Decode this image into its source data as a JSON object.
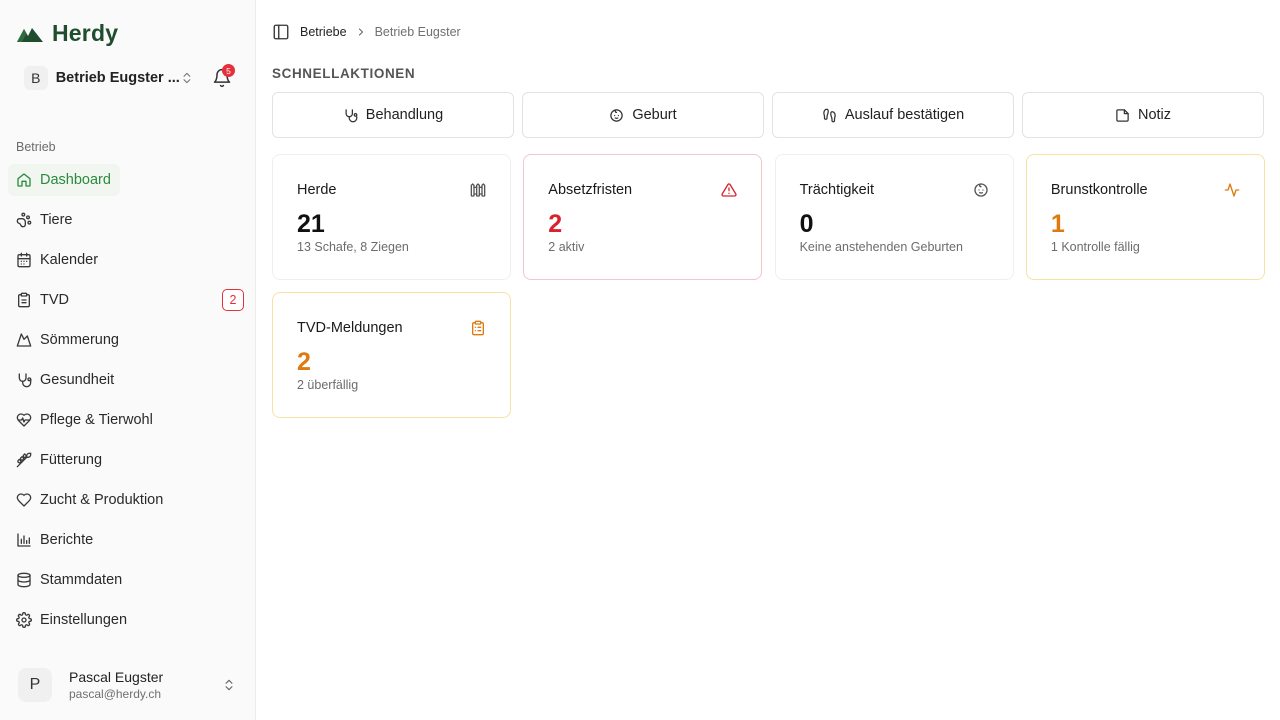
{
  "app": {
    "name": "Herdy"
  },
  "farm_switcher": {
    "avatar_letter": "B",
    "name": "Betrieb Eugster ..."
  },
  "notifications": {
    "count": "5"
  },
  "sidebar": {
    "section_label": "Betrieb",
    "items": [
      {
        "label": "Dashboard",
        "icon": "home-icon"
      },
      {
        "label": "Tiere",
        "icon": "paw-icon"
      },
      {
        "label": "Kalender",
        "icon": "calendar-icon"
      },
      {
        "label": "TVD",
        "icon": "clipboard-icon",
        "badge": "2"
      },
      {
        "label": "Sömmerung",
        "icon": "mountain-icon"
      },
      {
        "label": "Gesundheit",
        "icon": "stethoscope-icon"
      },
      {
        "label": "Pflege & Tierwohl",
        "icon": "heart-pulse-icon"
      },
      {
        "label": "Fütterung",
        "icon": "wheat-icon"
      },
      {
        "label": "Zucht & Produktion",
        "icon": "heart-icon"
      },
      {
        "label": "Berichte",
        "icon": "bar-chart-icon"
      },
      {
        "label": "Stammdaten",
        "icon": "database-icon"
      },
      {
        "label": "Einstellungen",
        "icon": "gear-icon"
      }
    ]
  },
  "user": {
    "avatar_letter": "P",
    "name": "Pascal Eugster",
    "email": "pascal@herdy.ch"
  },
  "breadcrumb": {
    "parent": "Betriebe",
    "current": "Betrieb Eugster"
  },
  "quick_actions": {
    "title": "SCHNELLAKTIONEN",
    "buttons": [
      {
        "label": "Behandlung",
        "icon": "stethoscope-icon"
      },
      {
        "label": "Geburt",
        "icon": "baby-icon"
      },
      {
        "label": "Auslauf bestätigen",
        "icon": "footprints-icon"
      },
      {
        "label": "Notiz",
        "icon": "note-icon"
      }
    ]
  },
  "cards": [
    {
      "title": "Herde",
      "value": "21",
      "sub": "13 Schafe, 8 Ziegen",
      "icon": "fence-icon",
      "tone": "neutral"
    },
    {
      "title": "Absetzfristen",
      "value": "2",
      "sub": "2 aktiv",
      "icon": "warning-icon",
      "tone": "red"
    },
    {
      "title": "Trächtigkeit",
      "value": "0",
      "sub": "Keine anstehenden Geburten",
      "icon": "baby-icon",
      "tone": "neutral"
    },
    {
      "title": "Brunstkontrolle",
      "value": "1",
      "sub": "1 Kontrolle fällig",
      "icon": "activity-icon",
      "tone": "amber"
    },
    {
      "title": "TVD-Meldungen",
      "value": "2",
      "sub": "2 überfällig",
      "icon": "clipboard-list-icon",
      "tone": "amber"
    }
  ],
  "colors": {
    "accent_green": "#2b8a3e",
    "danger": "#d8232f",
    "warning": "#dd7a10",
    "brand": "#1f4d2e"
  }
}
